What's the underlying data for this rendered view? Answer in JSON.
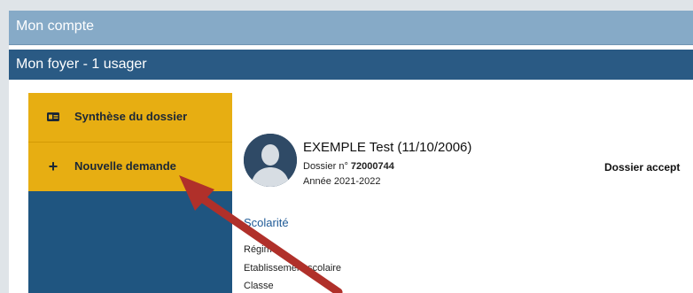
{
  "header": {
    "account_title": "Mon compte",
    "household_title": "Mon foyer - 1 usager"
  },
  "sidebar": {
    "items": [
      {
        "label": "Synthèse du dossier",
        "icon": "id-card-icon"
      },
      {
        "label": "Nouvelle demande",
        "icon": "plus-icon"
      }
    ]
  },
  "student": {
    "name": "EXEMPLE Test (11/10/2006)",
    "file_label": "Dossier n°",
    "file_number": "72000744",
    "year": "Année 2021-2022",
    "status": "Dossier accept"
  },
  "schooling": {
    "title": "Scolarité",
    "fields": [
      "Régime",
      "Etablissement scolaire",
      "Classe"
    ]
  },
  "colors": {
    "account_bar": "#86aac7",
    "household_bar": "#2a5a84",
    "sidebar_bg": "#1f5580",
    "menu_item": "#e7ae12",
    "section_title": "#1f5a96",
    "arrow": "#b0302a"
  }
}
